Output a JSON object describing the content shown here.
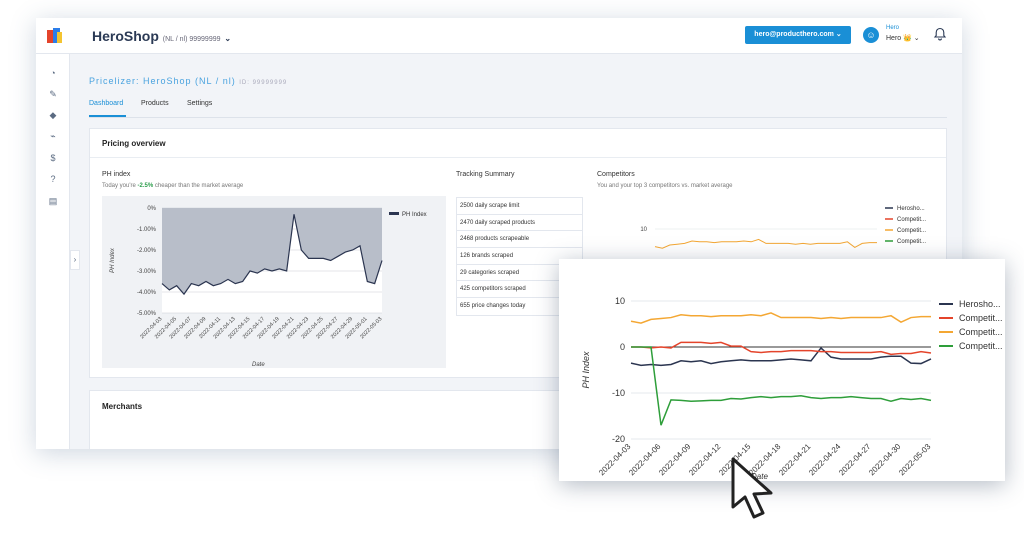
{
  "app": {
    "shop_name": "HeroShop",
    "shop_sub": "(NL / nl) 99999999",
    "email_button": "hero@producthero.com",
    "user_name": "Hero",
    "user_role": "Hero 👑",
    "colors": {
      "accent": "#1a8fd6",
      "sidebar_icon": "#5b6b82",
      "positive": "#2e9e4d"
    }
  },
  "sidebar": {
    "items": [
      {
        "icon": "dashboard-icon",
        "glyph": "◔"
      },
      {
        "icon": "pencil-icon",
        "glyph": "✎"
      },
      {
        "icon": "tag-icon",
        "glyph": "◆"
      },
      {
        "icon": "chart-icon",
        "glyph": "⌁"
      },
      {
        "icon": "dollar-icon",
        "glyph": "$"
      },
      {
        "icon": "help-icon",
        "glyph": "?"
      },
      {
        "icon": "clipboard-icon",
        "glyph": "▤"
      }
    ],
    "collapse_glyph": "›"
  },
  "page": {
    "title": "Pricelizer: HeroShop (NL / nl)",
    "title_id": "ID: 99999999",
    "tabs": [
      "Dashboard",
      "Products",
      "Settings"
    ],
    "active_tab": "Dashboard"
  },
  "overview": {
    "title": "Pricing overview",
    "ph_title": "PH index",
    "ph_sub_prefix": "Today you're ",
    "ph_sub_value": "-2.5%",
    "ph_sub_suffix": " cheaper than the market average",
    "tracking_title": "Tracking Summary",
    "tracking_rows": [
      "2500 daily scrape limit",
      "2470 daily scraped products",
      "2468 products scrapeable",
      "126 brands scraped",
      "29 categories scraped",
      "425 competitors scraped",
      "655 price changes today"
    ],
    "competitors_title": "Competitors",
    "competitors_sub": "You and your top 3 competitors vs. market average"
  },
  "merchants": {
    "title": "Merchants"
  },
  "chart_data": [
    {
      "type": "area",
      "xlabel": "Date",
      "ylabel": "PH Index",
      "ylim": [
        -5,
        0
      ],
      "yticks": [
        "0%",
        "-1.00%",
        "-2.00%",
        "-3.00%",
        "-4.00%",
        "-5.00%"
      ],
      "xticks": [
        "2022-04-03",
        "2022-04-05",
        "2022-04-07",
        "2022-04-09",
        "2022-04-11",
        "2022-04-13",
        "2022-04-15",
        "2022-04-17",
        "2022-04-19",
        "2022-04-21",
        "2022-04-23",
        "2022-04-25",
        "2022-04-27",
        "2022-04-29",
        "2022-05-01",
        "2022-05-03"
      ],
      "series": [
        {
          "name": "PH Index",
          "color": "#2b3550",
          "values": [
            -3.6,
            -3.9,
            -3.7,
            -4.1,
            -3.6,
            -3.7,
            -3.5,
            -3.7,
            -3.6,
            -3.4,
            -3.6,
            -3.5,
            -3.0,
            -3.1,
            -2.9,
            -3.0,
            -2.9,
            -3.0,
            -0.3,
            -2.0,
            -2.4,
            -2.4,
            -2.4,
            -2.5,
            -2.3,
            -2.1,
            -2.0,
            -1.8,
            -3.5,
            -3.6,
            -2.5
          ]
        }
      ],
      "grid": true,
      "legend": "top-right"
    },
    {
      "type": "line",
      "xlabel": "Date",
      "ylabel": "PH Index",
      "ylim": [
        -20,
        10
      ],
      "yticks": [
        "10",
        "0",
        "-10",
        "-20"
      ],
      "xticks": [
        "2022-04-03",
        "2022-04-06",
        "2022-04-09",
        "2022-04-12",
        "2022-04-15",
        "2022-04-18",
        "2022-04-21",
        "2022-04-24",
        "2022-04-27",
        "2022-04-30",
        "2022-05-03"
      ],
      "series": [
        {
          "name": "Herosho...",
          "color": "#2b3550",
          "values": [
            -3.5,
            -4,
            -3.8,
            -4,
            -3.8,
            -3,
            -3.2,
            -3,
            -3.6,
            -3.2,
            -3,
            -2.8,
            -3,
            -3,
            -3,
            -2.8,
            -2.6,
            -2.8,
            -3,
            -0.2,
            -2.2,
            -2.6,
            -2.6,
            -2.6,
            -2.6,
            -2.2,
            -2,
            -2,
            -3.5,
            -3.6,
            -2.6
          ]
        },
        {
          "name": "Competit...",
          "color": "#e4442b",
          "values": [
            0,
            0,
            -0.2,
            0,
            -0.2,
            1,
            1,
            1,
            0.8,
            1,
            0.2,
            0.2,
            -1,
            -1.2,
            -1,
            -1,
            -0.8,
            -0.8,
            -0.8,
            -1,
            -1,
            -1.2,
            -1.2,
            -1.2,
            -1.2,
            -1,
            -1.6,
            -1.4,
            -1.4,
            -1,
            -1.3
          ]
        },
        {
          "name": "Competit...",
          "color": "#f4a733",
          "values": [
            5.6,
            5.2,
            6,
            6.2,
            6.4,
            7,
            6.8,
            6.8,
            6.6,
            6.8,
            6.8,
            6.8,
            7,
            6.8,
            7.4,
            6.4,
            6.4,
            6.4,
            6.4,
            6.2,
            6.4,
            6.2,
            6.4,
            6.4,
            6.4,
            6.4,
            6.8,
            5.4,
            6.4,
            6.6,
            6.6
          ]
        },
        {
          "name": "Competit...",
          "color": "#2e9e3a",
          "values": [
            0,
            0,
            0,
            -17,
            -11.5,
            -11.6,
            -11.8,
            -11.7,
            -11.6,
            -11.6,
            -11.2,
            -11.3,
            -11,
            -10.8,
            -11,
            -10.8,
            -10.8,
            -10.6,
            -11,
            -11.2,
            -11,
            -11,
            -10.8,
            -11,
            -11.2,
            -11.2,
            -11.8,
            -11.2,
            -11.4,
            -11.2,
            -11.6
          ]
        }
      ],
      "grid": true,
      "legend": "right"
    }
  ]
}
